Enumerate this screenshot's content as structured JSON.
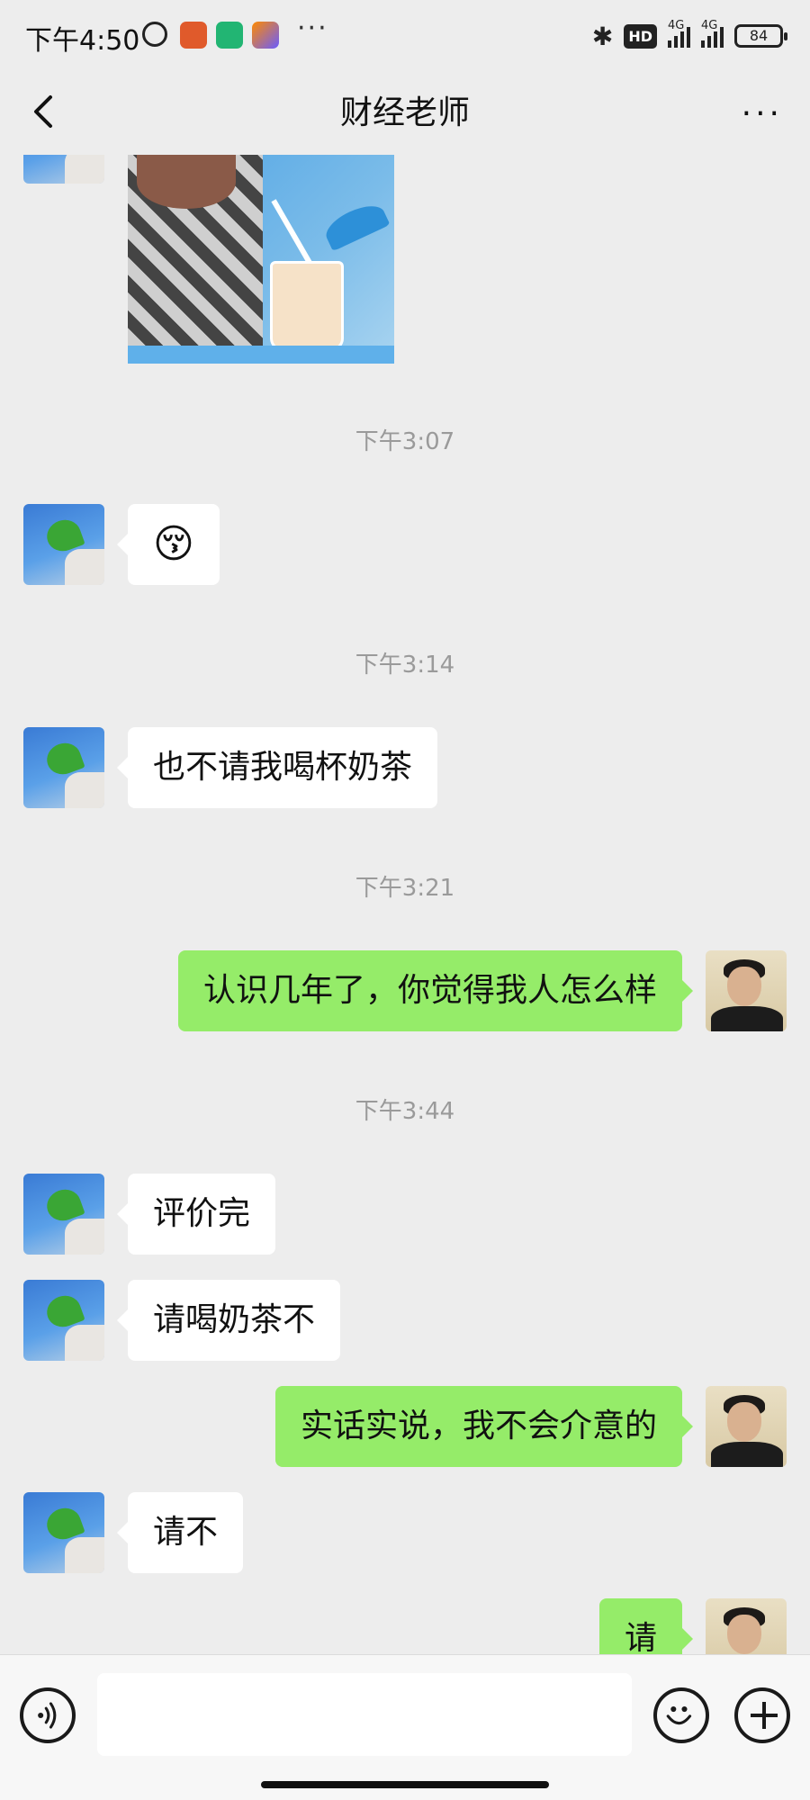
{
  "status_bar": {
    "time": "下午4:50",
    "network_hd": "HD",
    "sim1_label": "4G",
    "sim2_label": "4G",
    "battery": "84",
    "overflow": "···"
  },
  "header": {
    "title": "财经老师",
    "more": "···"
  },
  "messages": {
    "ts1": "下午3:07",
    "emoji1": "😚",
    "ts2": "下午3:14",
    "msg1": "也不请我喝杯奶茶",
    "ts3": "下午3:21",
    "msg2": "认识几年了，你觉得我人怎么样",
    "ts4": "下午3:44",
    "msg3": "评价完",
    "msg4": "请喝奶茶不",
    "msg5": "实话实说，我不会介意的",
    "msg6": "请不",
    "msg7": "请"
  },
  "colors": {
    "background": "#ededed",
    "bubble_in": "#ffffff",
    "bubble_out": "#95ec69"
  }
}
